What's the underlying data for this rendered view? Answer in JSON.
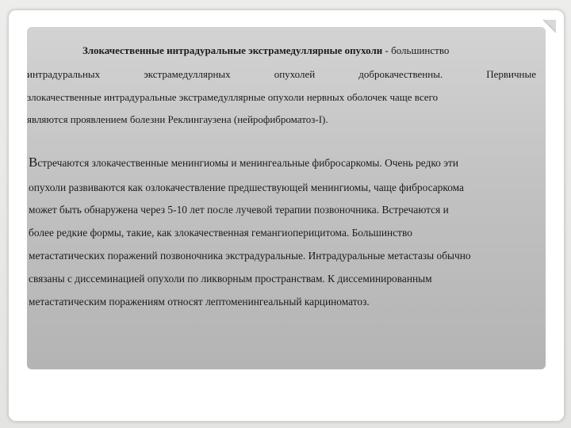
{
  "paragraph1": {
    "lead_bold": "Злокачественные интрадуральные экстрамедуллярные опухоли",
    "lead_rest": " - большинство",
    "line2_words": [
      "интрадуральных",
      "экстрамедуллярных",
      "опухолей",
      "доброкачественны.",
      "Первичные"
    ],
    "line3": "злокачественные интрадуральные экстрамедуллярные опухоли нервных оболочек чаще всего",
    "line4": "являются проявлением болезни Реклингаузена (нейрофиброматоз-I)."
  },
  "paragraph2": {
    "first_letter": "В",
    "line1_rest": "стречаются злокачественные менингиомы и менингеальные фибросаркомы. Очень редко эти",
    "line2": "опухоли развиваются как озлокачествление предшествующей менингиомы, чаще фибросаркома",
    "line3": "может быть обнаружена через 5-10 лет после лучевой терапии позвоночника. Встречаются и",
    "line4": "более редкие формы, такие, как злокачественная гемангиоперицитома. Большинство",
    "line5": "метастатических поражений позвоночника экстрадуральные. Интрадуральные метастазы обычно",
    "line6": "связаны с диссеминацией опухоли по ликворным пространствам. К диссеминированным",
    "line7": "метастатическим поражениям относят лептоменингеальный карциноматоз."
  }
}
